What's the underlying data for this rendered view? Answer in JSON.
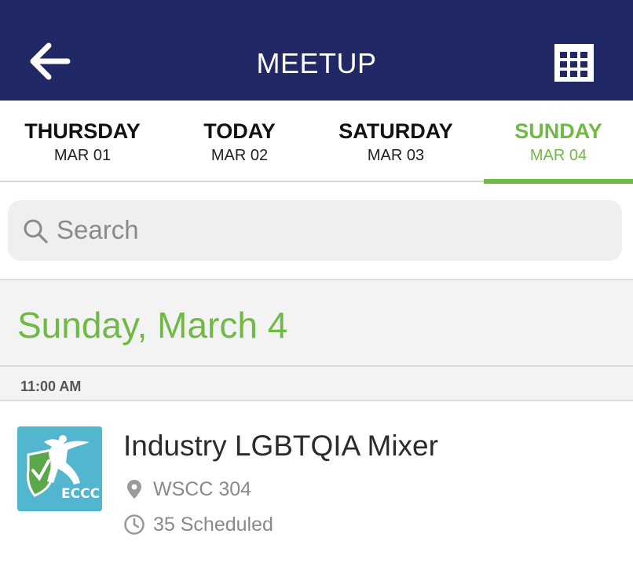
{
  "header": {
    "title": "MEETUP",
    "back_icon": "arrow-left-icon",
    "view_icon": "grid-calendar-icon",
    "background": "#212866"
  },
  "days": [
    {
      "name": "THURSDAY",
      "date": "MAR 01",
      "active": false
    },
    {
      "name": "TODAY",
      "date": "MAR 02",
      "active": false
    },
    {
      "name": "SATURDAY",
      "date": "MAR 03",
      "active": false
    },
    {
      "name": "SUNDAY",
      "date": "MAR 04",
      "active": true
    }
  ],
  "search": {
    "placeholder": "Search",
    "value": "",
    "icon": "search-icon"
  },
  "section": {
    "title": "Sunday, March 4"
  },
  "time_slot": "11:00 AM",
  "event": {
    "title": "Industry LGBTQIA Mixer",
    "location": "WSCC 304",
    "scheduled": "35 Scheduled",
    "logo_text": "ECCC",
    "location_icon": "map-pin-icon",
    "scheduled_icon": "clock-icon"
  },
  "colors": {
    "accent": "#6fba44",
    "header_bg": "#212866",
    "logo_bg": "#52b6cf"
  }
}
